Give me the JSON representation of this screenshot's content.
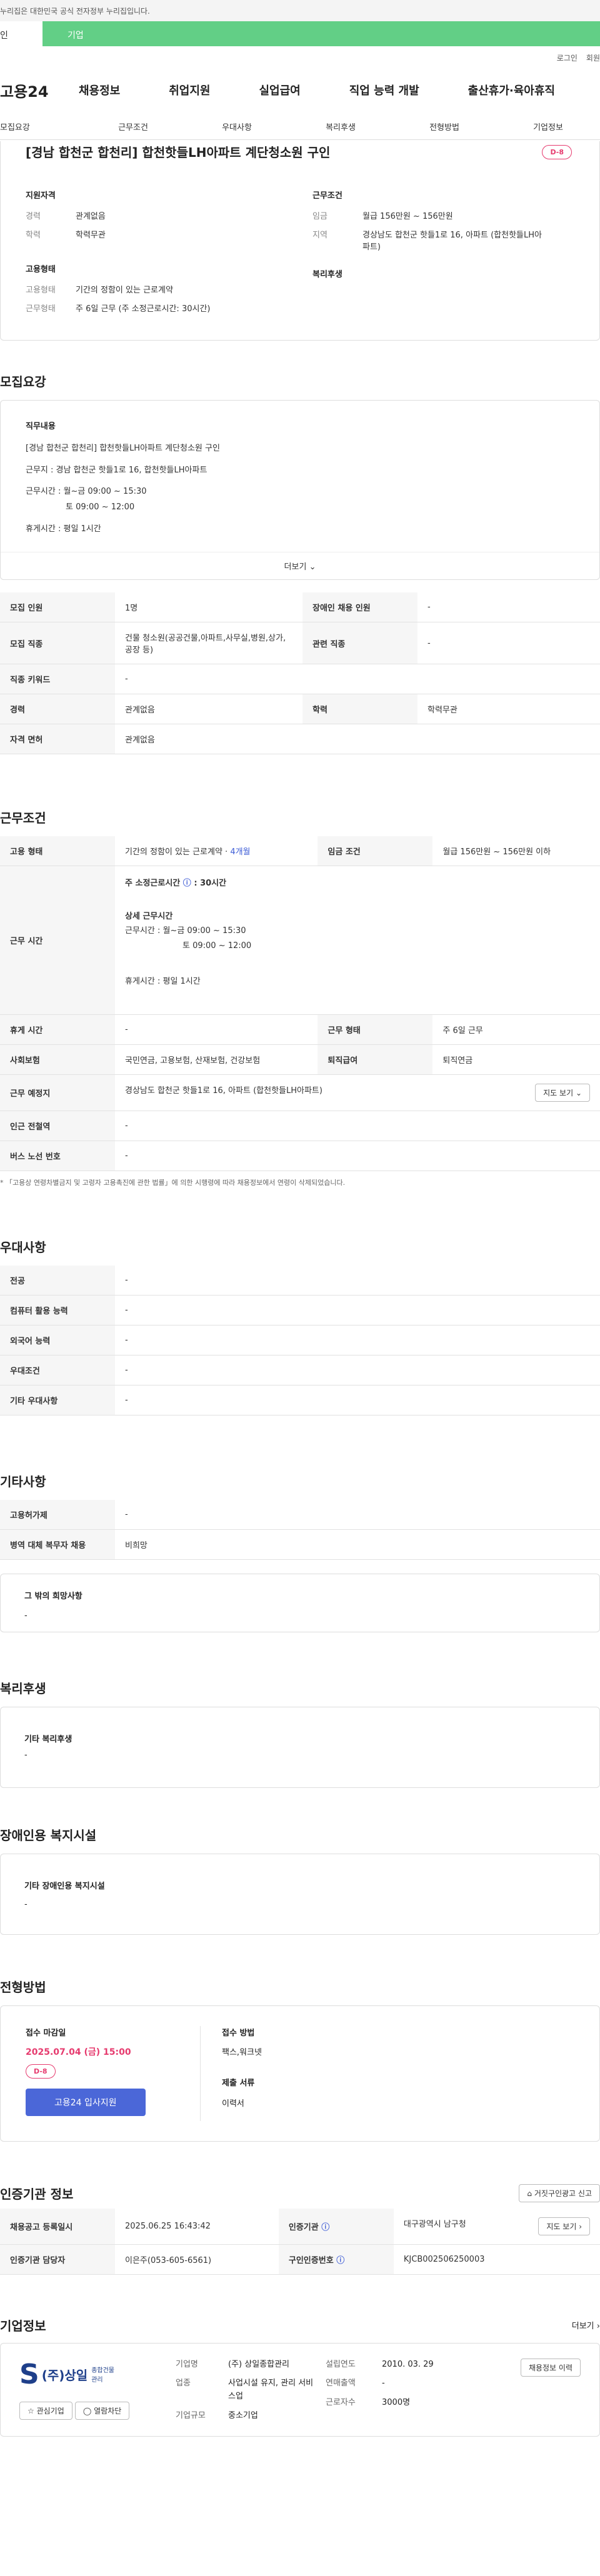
{
  "gov_notice": "누리집은 대한민국 공식 전자정부 누리집입니다.",
  "tabs": [
    "인",
    "기업"
  ],
  "util": [
    "로그인",
    "회원"
  ],
  "logo": "고용24",
  "gnb": [
    "채용정보",
    "취업지원",
    "실업급여",
    "직업 능력 개발",
    "출산휴가·육아휴직"
  ],
  "subnav": [
    "모집요강",
    "근무조건",
    "우대사항",
    "복리후생",
    "전형방법",
    "기업정보"
  ],
  "job": {
    "title": "[경남 합천군 합천리] 합천핫들LH아파트 계단청소원 구인",
    "dday": "D-8"
  },
  "summary": {
    "qual_title": "지원자격",
    "career_k": "경력",
    "career_v": "관계없음",
    "edu_k": "학력",
    "edu_v": "학력무관",
    "cond_title": "근무조건",
    "wage_k": "임금",
    "wage_v": "월급 156만원 ~ 156만원",
    "area_k": "지역",
    "area_v": "경상남도 합천군 핫들1로 16, 아파트 (합천핫들LH아파트)",
    "emp_title": "고용형태",
    "emptype_k": "고용형태",
    "emptype_v": "기간의 정함이 있는 근로계약",
    "worktype_k": "근무형태",
    "worktype_v": "주 6일 근무 (주 소정근로시간: 30시간)",
    "welfare_title": "복리후생"
  },
  "recruit": {
    "title": "모집요강",
    "duty_h": "직무내용",
    "lines": [
      "[경남 합천군 합천리] 합천핫들LH아파트 계단청소원 구인",
      "근무지 : 경남 합천군 핫들1로 16, 합천핫들LH아파트",
      "근무시간 : 월~금 09:00 ~ 15:30",
      "토 09:00 ~ 12:00",
      "휴게시간 : 평일 1시간"
    ],
    "more": "더보기"
  },
  "recruit_table": [
    [
      "모집 인원",
      "1명",
      "장애인 채용 인원",
      "-"
    ],
    [
      "모집 직종",
      "건물 청소원(공공건물,아파트,사무실,병원,상가,공장 등)",
      "관련 직종",
      "-"
    ],
    [
      "직종 키워드",
      "-",
      "",
      ""
    ],
    [
      "경력",
      "관계없음",
      "학력",
      "학력무관"
    ],
    [
      "자격 면허",
      "관계없음",
      "",
      ""
    ]
  ],
  "cond": {
    "title": "근무조건",
    "rows1": [
      "고용 형태",
      "기간의 정함이 있는 근로계약",
      "4개월",
      "임금 조건",
      "월급 156만원 ~ 156만원 이하"
    ],
    "hours_k": "근무 시간",
    "hours_main": "주 소정근로시간",
    "hours_val": "30시간",
    "detail_h": "상세 근무시간",
    "detail": [
      "근무시간 : 월~금 09:00 ~ 15:30",
      "토 09:00 ~ 12:00",
      "휴게시간 : 평일 1시간"
    ],
    "rows": [
      [
        "휴게 시간",
        "-",
        "근무 형태",
        "주 6일 근무"
      ],
      [
        "사회보험",
        "국민연금, 고용보험, 산재보험, 건강보험",
        "퇴직급여",
        "퇴직연금"
      ]
    ],
    "place_k": "근무 예정지",
    "place_v": "경상남도 합천군 핫들1로 16, 아파트 (합천핫들LH아파트)",
    "map": "지도 보기",
    "station_k": "인근 전철역",
    "station_v": "-",
    "bus_k": "버스 노선 번호",
    "bus_v": "-",
    "note": "* 「고용상 연령차별금지 및 고령자 고용촉진에 관한 법률」에 의한 시행령에 따라 채용정보에서 연령이 삭제되었습니다."
  },
  "pref": {
    "title": "우대사항",
    "rows": [
      [
        "전공",
        "-"
      ],
      [
        "컴퓨터 활용 능력",
        "-"
      ],
      [
        "외국어 능력",
        "-"
      ],
      [
        "우대조건",
        "-"
      ],
      [
        "기타 우대사항",
        "-"
      ]
    ]
  },
  "etc": {
    "title": "기타사항",
    "rows": [
      [
        "고용허가제",
        "-"
      ],
      [
        "병역 대체 복무자 채용",
        "비희망"
      ]
    ],
    "hope_h": "그 밖의 희망사항",
    "hope_v": "-"
  },
  "welfare": {
    "title": "복리후생",
    "h": "기타 복리후생",
    "v": "-"
  },
  "disab": {
    "title": "장애인용 복지시설",
    "h": "기타 장애인용 복지시설",
    "v": "-"
  },
  "apply": {
    "title": "전형방법",
    "deadline_h": "접수 마감일",
    "deadline_v": "2025.07.04 (금) 15:00",
    "dday": "D-8",
    "btn": "고용24 입사지원",
    "method_h": "접수 방법",
    "method_v": "팩스,워크넷",
    "docs_h": "제출 서류",
    "docs_v": "이력서"
  },
  "cert": {
    "title": "인증기관 정보",
    "report": "거짓구인광고 신고",
    "rows": [
      [
        "채용공고 등록일시",
        "2025.06.25 16:43:42",
        "인증기관",
        "대구광역시 남구청"
      ],
      [
        "인증기관 담당자",
        "이은주(053-605-6561)",
        "구인인증번호",
        "KJCB002506250003"
      ]
    ],
    "map": "지도 보기"
  },
  "company": {
    "title": "기업정보",
    "more": "더보기",
    "logo_text": "(주)상일",
    "logo_sub": "종합건물관리",
    "fav": "관심기업",
    "block": "열람차단",
    "name_k": "기업명",
    "name_v": "(주) 상일종합관리",
    "ind_k": "업종",
    "ind_v": "사업시설 유지, 관리 서비스업",
    "scale_k": "기업규모",
    "scale_v": "중소기업",
    "est_k": "설립연도",
    "est_v": "2010. 03. 29",
    "sales_k": "연매출액",
    "sales_v": "-",
    "emp_k": "근로자수",
    "emp_v": "3000명",
    "job_btn": "채용정보 이력"
  }
}
